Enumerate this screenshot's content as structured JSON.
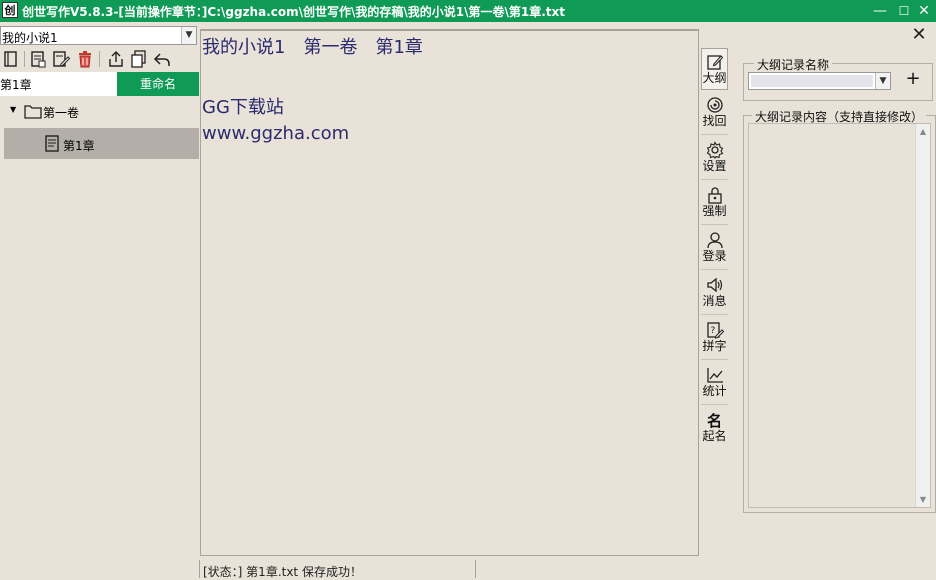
{
  "window": {
    "title": "创世写作V5.8.3-[当前操作章节：]C:\\ggzha.com\\创世写作\\我的存稿\\我的小说1\\第一卷\\第1章.txt",
    "app_icon": "创",
    "minimize": "—",
    "maximize": "☐",
    "close": "✕"
  },
  "panel_close": "✕",
  "left": {
    "book_select": "我的小说1",
    "chapter_name_value": "第1章",
    "rename_label": "重命名",
    "toolbar_icons": [
      "book-icon",
      "new-chapter-icon",
      "edit-icon",
      "delete-icon",
      "export-icon",
      "copy-icon",
      "undo-icon"
    ],
    "tree": {
      "volume": "第一卷",
      "chapter": "第1章"
    }
  },
  "editor": {
    "lines": [
      "我的小说1　第一卷　第1章",
      "",
      "GG下载站",
      "www.ggzha.com"
    ]
  },
  "status": {
    "text": "[状态：] 第1章.txt  保存成功！"
  },
  "side_tools": [
    {
      "label": "大纲",
      "icon": "outline-icon"
    },
    {
      "label": "找回",
      "icon": "recover-icon"
    },
    {
      "label": "设置",
      "icon": "gear-icon"
    },
    {
      "label": "强制",
      "icon": "lock-icon"
    },
    {
      "label": "登录",
      "icon": "user-icon"
    },
    {
      "label": "消息",
      "icon": "speaker-icon"
    },
    {
      "label": "拼字",
      "icon": "spell-icon"
    },
    {
      "label": "统计",
      "icon": "chart-icon"
    },
    {
      "label": "起名",
      "icon": "name-icon"
    }
  ],
  "outline": {
    "name_legend": "大纲记录名称",
    "name_value": "",
    "add": "+",
    "content_legend": "大纲记录内容（支持直接修改）",
    "content_value": ""
  },
  "colors": {
    "accent": "#0f9a55",
    "background": "#e8e2d8",
    "editor_text": "#2b2b6e"
  }
}
